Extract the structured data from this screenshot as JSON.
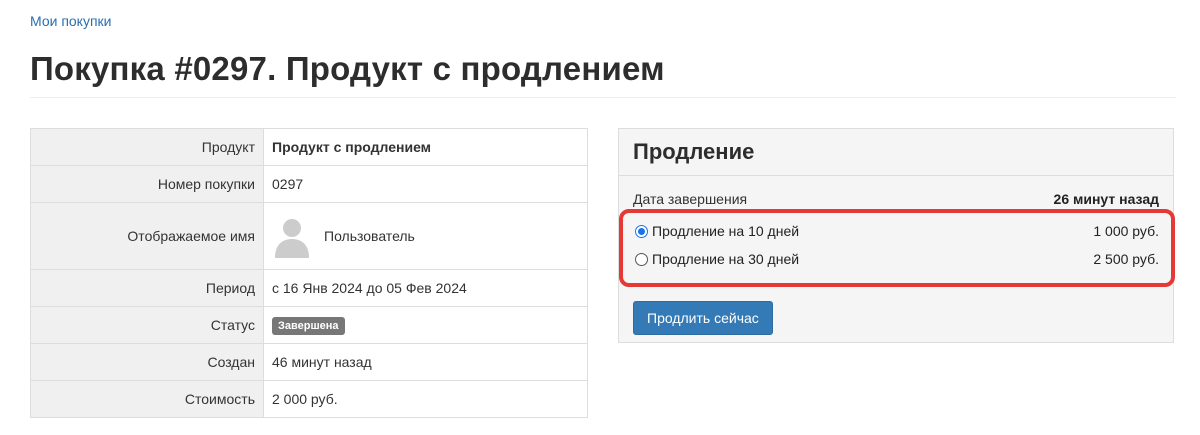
{
  "breadcrumb": {
    "label": "Мои покупки"
  },
  "page": {
    "title": "Покупка #0297. Продукт с продлением"
  },
  "details": {
    "rows": [
      {
        "label": "Продукт",
        "value": "Продукт с продлением"
      },
      {
        "label": "Номер покупки",
        "value": "0297"
      },
      {
        "label": "Отображаемое имя",
        "value": "Пользователь",
        "icon": "user-avatar-placeholder"
      },
      {
        "label": "Период",
        "value": "с 16 Янв 2024 до 05 Фев 2024"
      },
      {
        "label": "Статус",
        "value": "Завершена"
      },
      {
        "label": "Создан",
        "value": "46 минут назад"
      },
      {
        "label": "Стоимость",
        "value": "2 000 руб."
      }
    ]
  },
  "renewal": {
    "title": "Продление",
    "end_label": "Дата завершения",
    "end_value": "26 минут назад",
    "options": [
      {
        "label": "Продление на 10 дней",
        "price": "1 000 руб.",
        "selected": true
      },
      {
        "label": "Продление на 30 дней",
        "price": "2 500 руб.",
        "selected": false
      }
    ],
    "button_label": "Продлить сейчас",
    "highlight_color": "#e53935"
  },
  "colors": {
    "link": "#2a6fb0",
    "primary_button": "#337ab7",
    "badge": "#777777"
  }
}
